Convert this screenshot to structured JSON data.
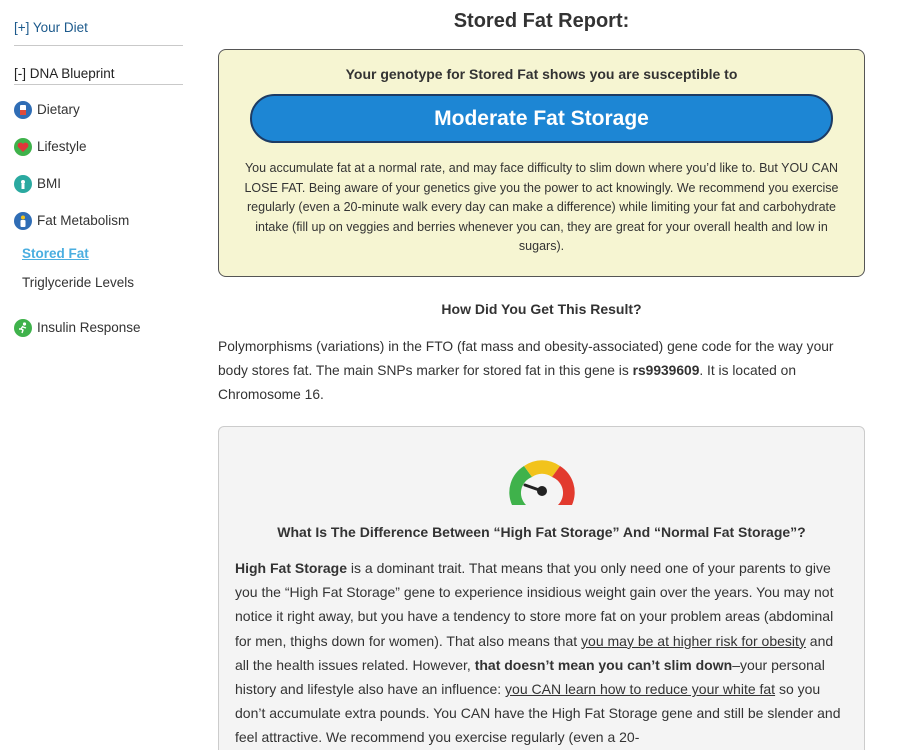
{
  "sidebar": {
    "your_diet": "[+] Your Diet",
    "dna_blueprint": "[-] DNA Blueprint",
    "items": [
      {
        "label": "Dietary",
        "icon": "dietary-icon"
      },
      {
        "label": "Lifestyle",
        "icon": "heart-icon"
      },
      {
        "label": "BMI",
        "icon": "bmi-icon"
      },
      {
        "label": "Fat Metabolism",
        "icon": "fat-metabolism-icon"
      }
    ],
    "sub_items": [
      {
        "label": "Stored Fat",
        "active": true
      },
      {
        "label": "Triglyceride Levels",
        "active": false
      }
    ],
    "insulin": {
      "label": "Insulin Response",
      "icon": "runner-icon"
    }
  },
  "report": {
    "title": "Stored Fat Report:",
    "lead": "Your genotype for Stored Fat shows you are susceptible to",
    "result": "Moderate Fat Storage",
    "description": "You accumulate fat at a normal rate, and may face difficulty to slim down where you’d like to. But YOU CAN LOSE FAT. Being aware of your genetics give you the power to act knowingly. We recommend you exercise regularly (even a 20-minute walk every day can make a difference) while limiting your fat and carbohydrate intake (fill up on veggies and berries whenever you can, they are great for your overall health and low in sugars)."
  },
  "how": {
    "title": "How Did You Get This Result?",
    "text_1": "Polymorphisms (variations) in the FTO (fat mass and obesity-associated) gene code for the way your body stores fat. The main SNPs marker for stored fat in this gene is ",
    "snp": "rs9939609",
    "text_2": ". It is located on Chromosome 16."
  },
  "difference": {
    "title": "What Is The Difference Between “High Fat Storage” And “Normal Fat Storage”?",
    "bold_1": "High Fat Storage",
    "text_1": " is a dominant trait. That means that you only need one of your parents to give you the “High Fat Storage” gene to experience insidious weight gain over the years. You may not notice it right away, but you have a tendency to store more fat on your problem areas (abdominal for men, thighs down for women). That also means that ",
    "link_1": "you may be at higher risk for obesity",
    "text_2": " and all the health issues related. However, ",
    "bold_2": "that doesn’t mean you can’t slim down",
    "text_3": "–your personal history and lifestyle also have an influence: ",
    "link_2": "you CAN learn how to reduce your white fat",
    "text_4": " so you don’t accumulate extra pounds. You CAN have the High Fat Storage gene and still be slender and feel attractive. We recommend you exercise regularly (even a 20-"
  },
  "colors": {
    "pill_blue": "#1d86d4",
    "result_box_bg": "#f6f5d2",
    "active_link": "#4aaee0",
    "gauge_green": "#3fb24b",
    "gauge_yellow": "#f2c31b",
    "gauge_red": "#e23a2e"
  }
}
